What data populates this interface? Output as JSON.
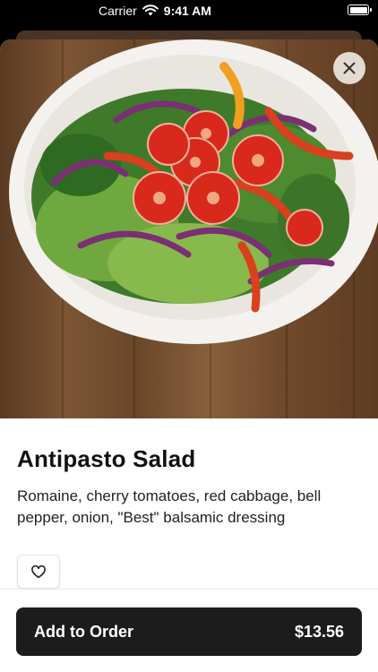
{
  "status_bar": {
    "carrier": "Carrier",
    "time": "9:41 AM"
  },
  "item": {
    "name": "Antipasto Salad",
    "description": "Romaine, cherry tomatoes, red cabbage, bell pepper, onion, \"Best\" balsamic dressing",
    "price": "$13.56"
  },
  "actions": {
    "add_to_order_label": "Add to Order"
  },
  "icons": {
    "close": "close-icon",
    "favorite": "heart-outline-icon",
    "wifi": "wifi-icon",
    "battery": "battery-icon"
  },
  "colors": {
    "primary_button": "#1c1c1c",
    "sheet_background": "#ffffff"
  }
}
